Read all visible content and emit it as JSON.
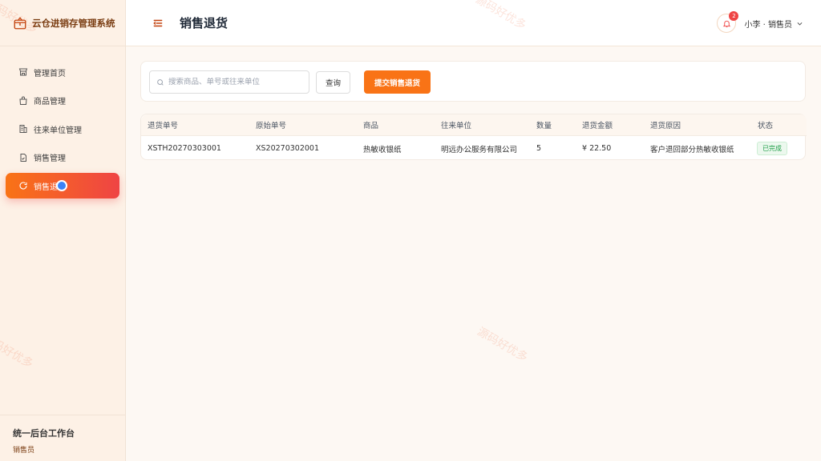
{
  "brand": {
    "title": "云仓进销存管理系统"
  },
  "sidebar": {
    "items": [
      {
        "label": "管理首页",
        "icon": "store-icon"
      },
      {
        "label": "商品管理",
        "icon": "bag-icon"
      },
      {
        "label": "往来单位管理",
        "icon": "building-icon"
      },
      {
        "label": "销售管理",
        "icon": "document-icon"
      },
      {
        "label": "销售退",
        "icon": "refresh-icon",
        "active": true
      }
    ],
    "footer_title": "统一后台工作台",
    "footer_role": "销售员"
  },
  "header": {
    "title": "销售退货",
    "notification_count": "2",
    "user_label": "小李 · 销售员"
  },
  "search": {
    "placeholder": "搜索商品、单号或往来单位",
    "value": "",
    "query_label": "查询",
    "submit_label": "提交销售退货"
  },
  "table": {
    "columns": [
      "退货单号",
      "原始单号",
      "商品",
      "往来单位",
      "数量",
      "退货金额",
      "退货原因",
      "状态"
    ],
    "rows": [
      [
        "XSTH20270303001",
        "XS20270302001",
        "热敏收银纸",
        "明远办公服务有限公司",
        "5",
        "¥ 22.50",
        "客户退回部分热敏收银纸",
        "已完成"
      ]
    ]
  },
  "watermark_text": "源码好优多",
  "colors": {
    "accent": "#f97316",
    "accent_end": "#ef4444",
    "success": "#22a04a"
  }
}
